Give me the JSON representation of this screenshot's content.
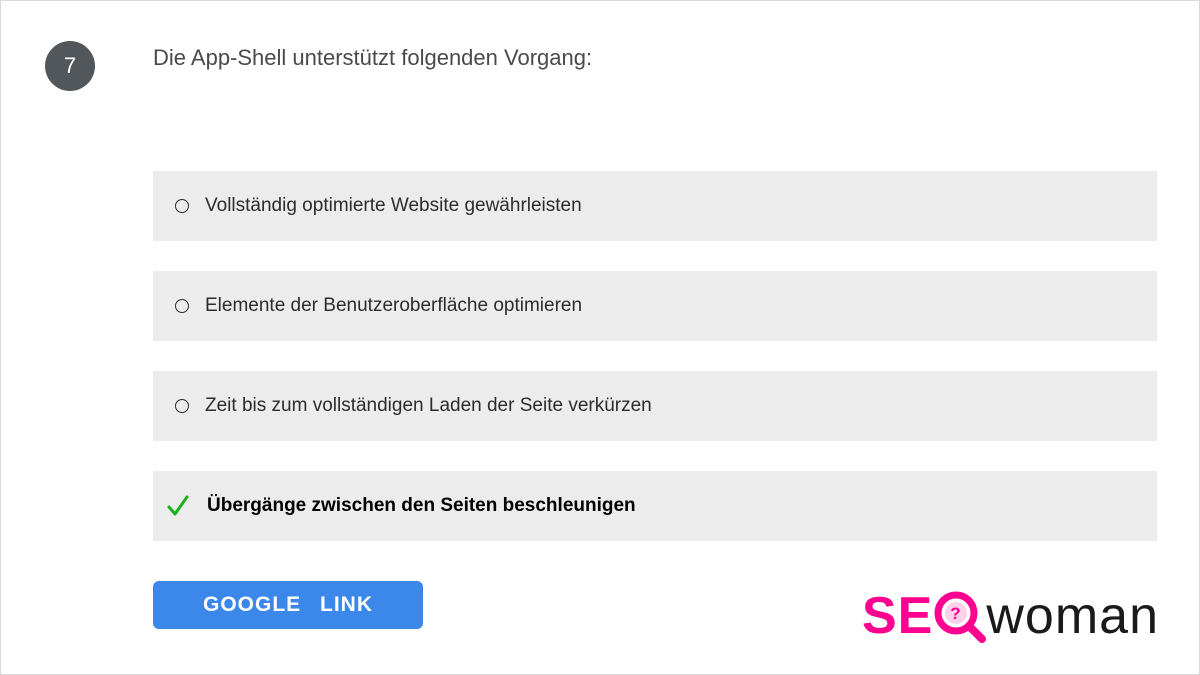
{
  "question": {
    "number": "7",
    "text": "Die App-Shell unterstützt folgenden Vorgang:"
  },
  "options": [
    {
      "label": "Vollständig optimierte Website gewährleisten",
      "correct": false
    },
    {
      "label": "Elemente der Benutzeroberfläche optimieren",
      "correct": false
    },
    {
      "label": "Zeit bis zum vollständigen Laden der Seite verkürzen",
      "correct": false
    },
    {
      "label": "Übergänge zwischen den Seiten beschleunigen",
      "correct": true
    }
  ],
  "button": {
    "google_link": "GOOGLE LINK"
  },
  "logo": {
    "se": "SE",
    "woman": "woman"
  }
}
